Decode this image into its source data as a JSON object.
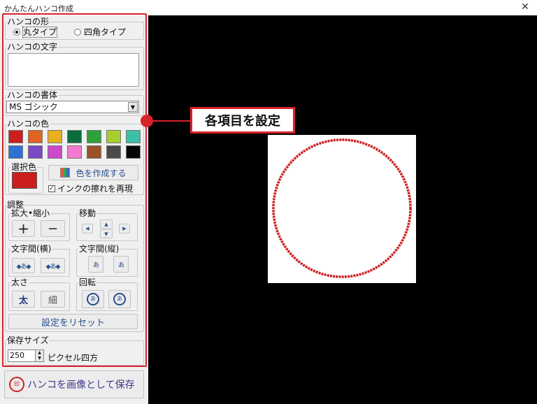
{
  "window": {
    "title": "かんたんハンコ作成",
    "close_glyph": "✕"
  },
  "shape": {
    "label": "ハンコの形",
    "options": [
      {
        "label": "丸タイプ",
        "selected": true
      },
      {
        "label": "四角タイプ",
        "selected": false
      }
    ]
  },
  "text": {
    "label": "ハンコの文字",
    "value": ""
  },
  "font": {
    "label": "ハンコの書体",
    "value": "MS ゴシック"
  },
  "color": {
    "label": "ハンコの色",
    "swatches": [
      "#cc1e1e",
      "#e06420",
      "#e8b01c",
      "#0a6e3c",
      "#2ea23a",
      "#a6cf2c",
      "#3cc0a8",
      "#2c72d0",
      "#7c48c4",
      "#cc48cc",
      "#f07ad0",
      "#9a5228",
      "#4a4a4a",
      "#060606"
    ],
    "selected_label": "選択色",
    "selected_value": "#cc1e1e",
    "create_button": "色を作成する",
    "ink_blur": {
      "label": "インクの擦れを再現",
      "checked": true
    }
  },
  "adjust": {
    "label": "調整",
    "zoom": {
      "label": "拡大•縮小",
      "plus": "+",
      "minus": "−"
    },
    "move": {
      "label": "移動",
      "left": "◀",
      "up": "▲",
      "down": "▼",
      "right": "▶"
    },
    "spacing_h": {
      "label": "文字間(横)",
      "narrow": "◆あ◆",
      "wide": "◆あ◆"
    },
    "spacing_v": {
      "label": "文字間(縦)",
      "narrow": "あ",
      "wide": "あ"
    },
    "weight": {
      "label": "太さ",
      "bold": "太",
      "thin": "細"
    },
    "rotate": {
      "label": "回転",
      "ccw": "あ",
      "cw": "あ"
    },
    "reset_button": "設定をリセット"
  },
  "save_size": {
    "label": "保存サイズ",
    "value": "250",
    "unit": "ピクセル四方"
  },
  "save_button": {
    "label": "ハンコを画像として保存",
    "seal_text": "印"
  },
  "callout": {
    "text": "各項目を設定",
    "accent": "#d8232a"
  },
  "stamp_color": "#cc1e1e"
}
